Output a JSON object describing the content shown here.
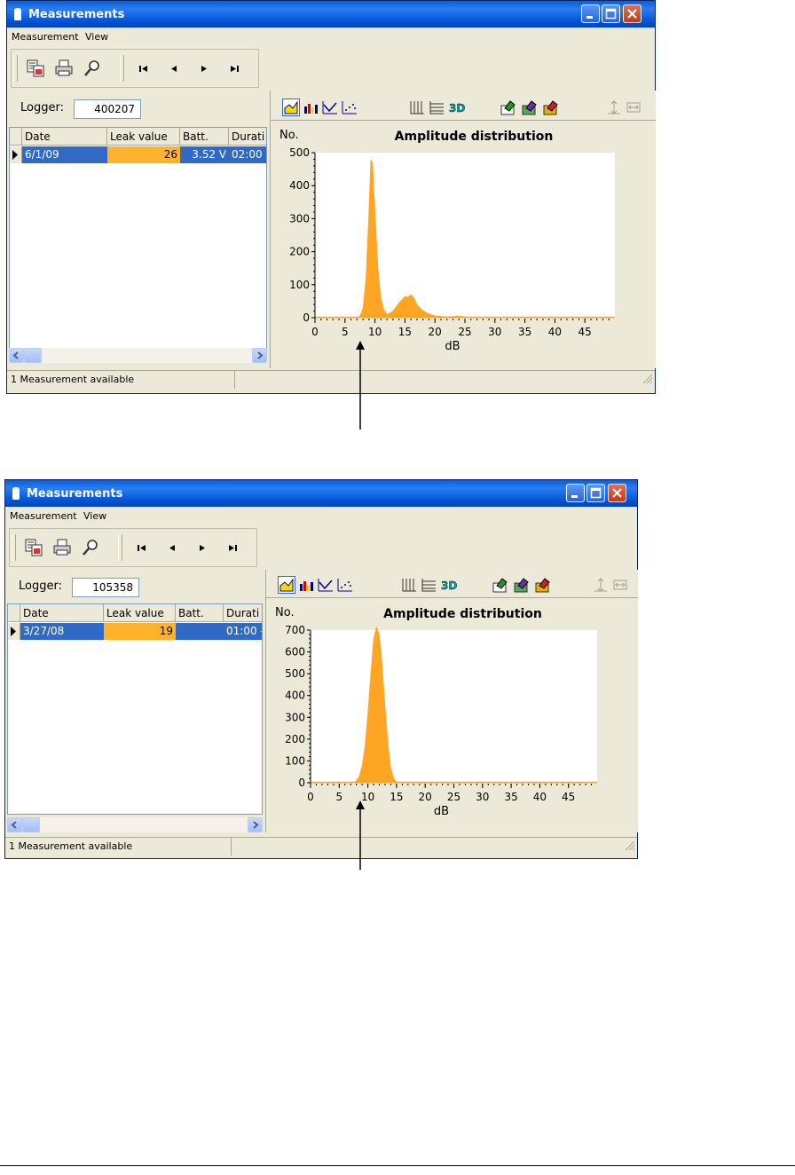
{
  "windows": [
    {
      "title": "Measurements",
      "menu": [
        "Measurement",
        "View"
      ],
      "logger_label": "Logger:",
      "logger_value": "400207",
      "columns": [
        "Date",
        "Leak value",
        "Batt.",
        "Durati"
      ],
      "row": {
        "date": "6/1/09",
        "leak": "26",
        "batt": "3.52 V",
        "duration": "02:00 -"
      },
      "status": "1 Measurement available",
      "chart_data": {
        "type": "area",
        "title": "Amplitude distribution",
        "xlabel": "dB",
        "ylabel": "No.",
        "xlim": [
          0,
          50
        ],
        "ylim": [
          0,
          500
        ],
        "xticks": [
          0,
          5,
          10,
          15,
          20,
          25,
          30,
          35,
          40,
          45
        ],
        "yticks": [
          0,
          100,
          200,
          300,
          400,
          500
        ],
        "x": [
          0,
          7,
          7.5,
          8,
          8.5,
          9,
          9.3,
          9.6,
          10,
          10.5,
          11,
          11.5,
          12,
          13,
          14,
          15,
          15.5,
          16,
          16.5,
          17,
          18,
          19,
          20,
          22,
          24,
          26,
          50
        ],
        "y": [
          0,
          0,
          5,
          30,
          120,
          330,
          480,
          470,
          330,
          150,
          60,
          25,
          10,
          20,
          45,
          65,
          62,
          70,
          60,
          40,
          22,
          12,
          6,
          3,
          5,
          1,
          0
        ],
        "color": "#ffa524"
      }
    },
    {
      "title": "Measurements",
      "menu": [
        "Measurement",
        "View"
      ],
      "logger_label": "Logger:",
      "logger_value": "105358",
      "columns": [
        "Date",
        "Leak value",
        "Batt.",
        "Durati"
      ],
      "row": {
        "date": "3/27/08",
        "leak": "19",
        "batt": "",
        "duration": "01:00 -"
      },
      "status": "1 Measurement available",
      "chart_data": {
        "type": "area",
        "title": "Amplitude distribution",
        "xlabel": "dB",
        "ylabel": "No.",
        "xlim": [
          0,
          50
        ],
        "ylim": [
          0,
          700
        ],
        "xticks": [
          0,
          5,
          10,
          15,
          20,
          25,
          30,
          35,
          40,
          45
        ],
        "yticks": [
          0,
          100,
          200,
          300,
          400,
          500,
          600,
          700
        ],
        "x": [
          0,
          7.5,
          8,
          8.5,
          9,
          9.5,
          10,
          10.5,
          11,
          11.5,
          12,
          12.5,
          13,
          13.5,
          14,
          14.5,
          15,
          15.5,
          50
        ],
        "y": [
          0,
          0,
          10,
          30,
          80,
          170,
          320,
          500,
          660,
          715,
          680,
          540,
          350,
          180,
          70,
          20,
          5,
          0,
          0
        ],
        "color": "#ffa524"
      }
    }
  ],
  "colors": {
    "title_bar": "#0a5fd8",
    "selection": "#316ac5",
    "leak_highlight": "#ffb22c",
    "series": "#ffa524"
  },
  "icons": [
    "copy-to-clipboard-icon",
    "print-icon",
    "preview-icon",
    "first-record-icon",
    "previous-record-icon",
    "next-record-icon",
    "last-record-icon",
    "area-chart-icon",
    "bar-chart-icon",
    "line-chart-icon",
    "scatter-chart-icon",
    "vertical-grid-icon",
    "horizontal-grid-icon",
    "3d-icon",
    "color-1-icon",
    "color-2-icon",
    "color-3-icon",
    "vertical-zoom-icon",
    "horizontal-zoom-icon"
  ]
}
